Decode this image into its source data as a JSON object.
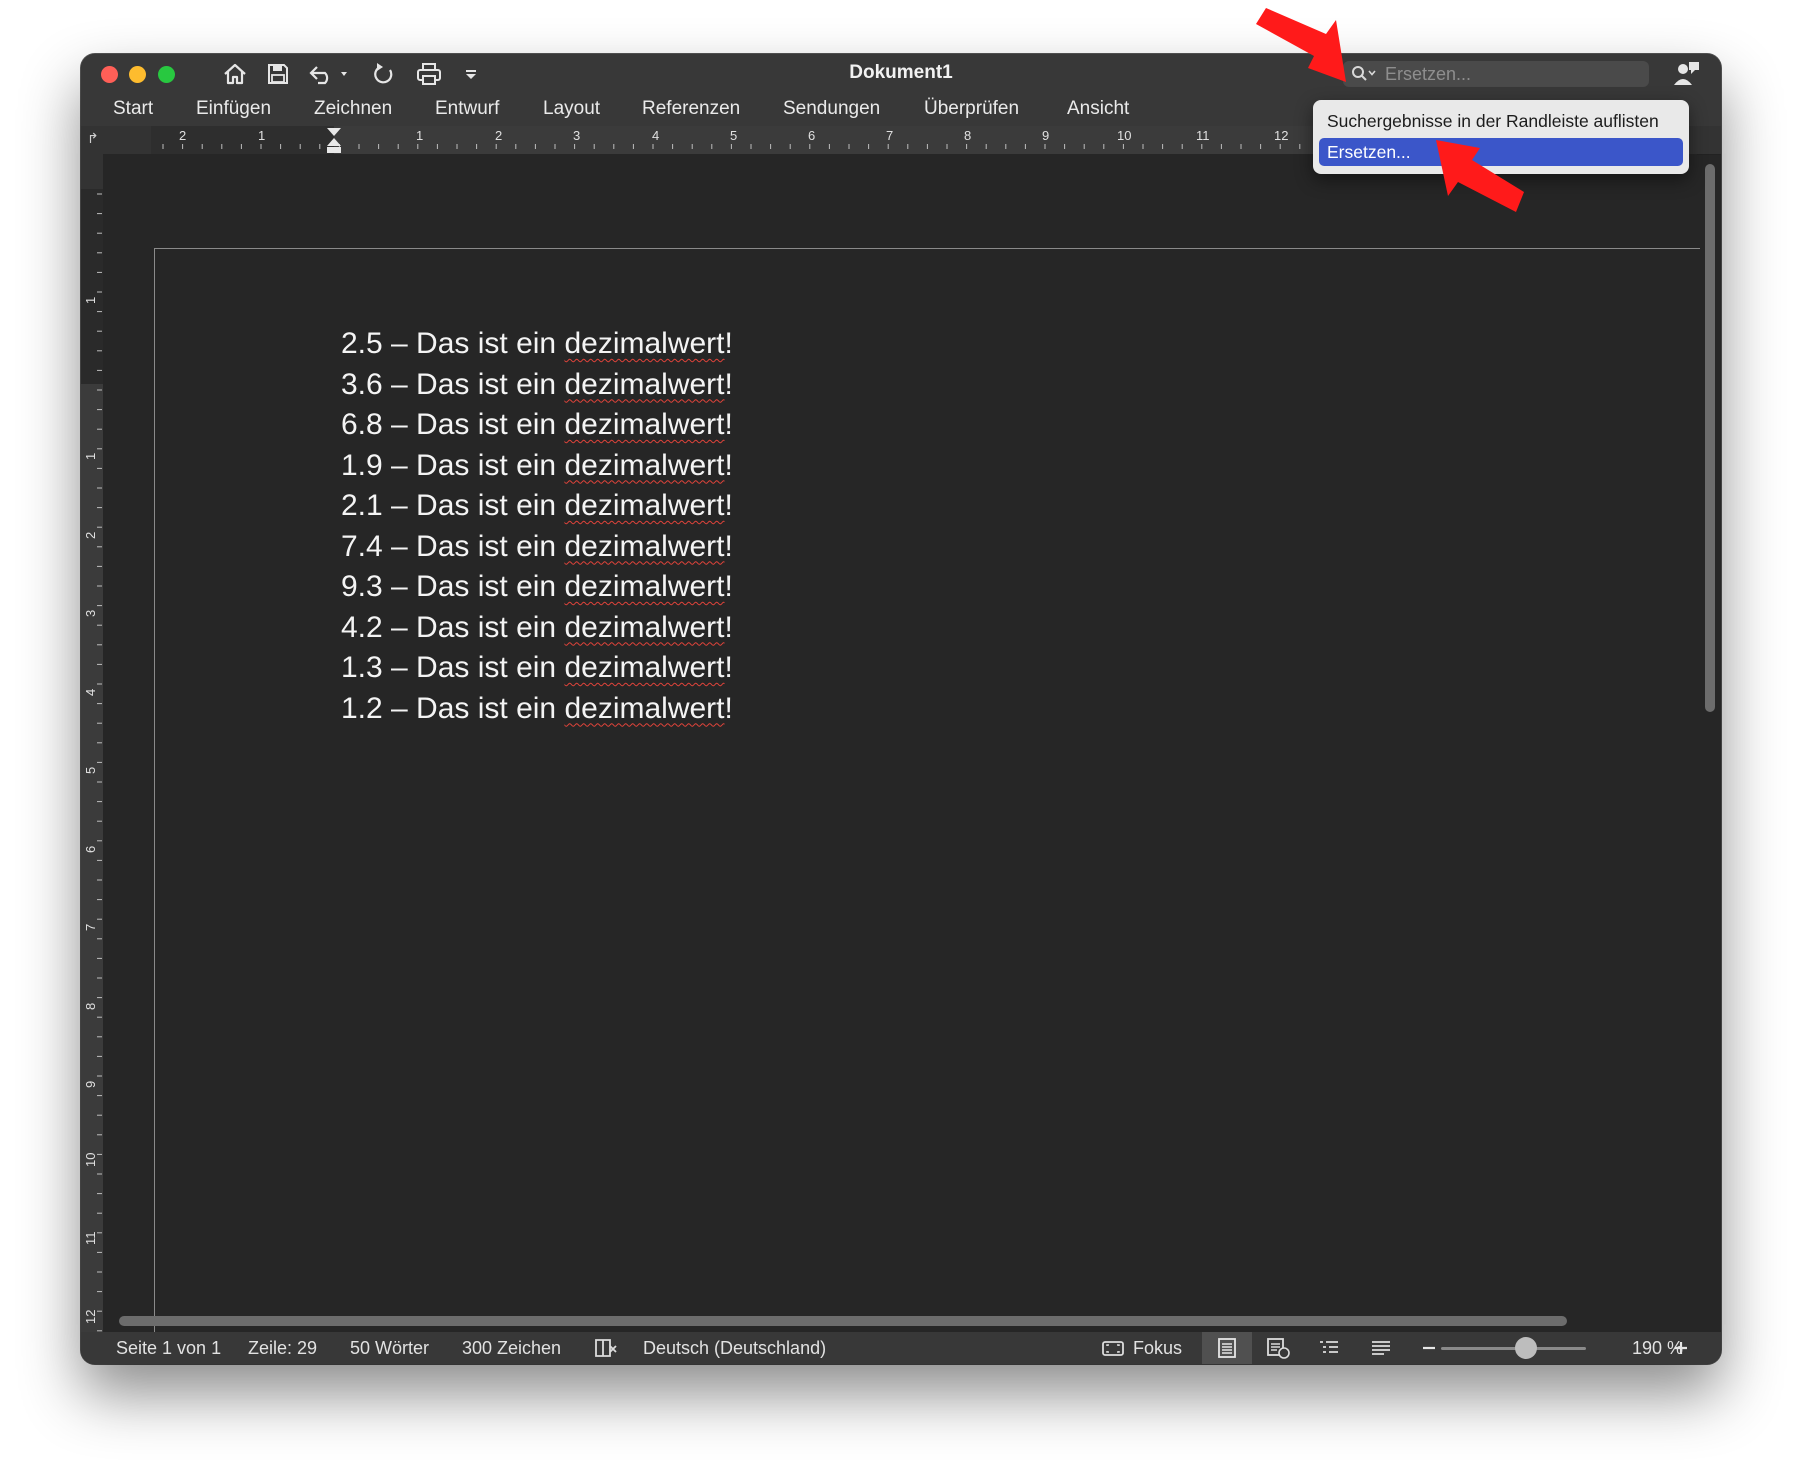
{
  "window": {
    "title": "Dokument1"
  },
  "search": {
    "placeholder": "Ersetzen..."
  },
  "ribbon": {
    "tabs": [
      "Start",
      "Einfügen",
      "Zeichnen",
      "Entwurf",
      "Layout",
      "Referenzen",
      "Sendungen",
      "Überprüfen",
      "Ansicht"
    ]
  },
  "ruler": {
    "h_labels": [
      "2",
      "1",
      "1",
      "2",
      "3",
      "4",
      "5",
      "6",
      "7",
      "8",
      "9",
      "10",
      "11",
      "12"
    ],
    "v_labels": [
      "1",
      "1",
      "2",
      "3",
      "4",
      "5",
      "6",
      "7",
      "8",
      "9",
      "10",
      "11",
      "12"
    ]
  },
  "document": {
    "lines": [
      {
        "prefix": "2.5 – Das ist ein ",
        "word": "dezimalwert",
        "suffix": "!"
      },
      {
        "prefix": "3.6 – Das ist ein ",
        "word": "dezimalwert",
        "suffix": "!"
      },
      {
        "prefix": "6.8 – Das ist ein ",
        "word": "dezimalwert",
        "suffix": "!"
      },
      {
        "prefix": "1.9 – Das ist ein ",
        "word": "dezimalwert",
        "suffix": "!"
      },
      {
        "prefix": "2.1 – Das ist ein ",
        "word": "dezimalwert",
        "suffix": "!"
      },
      {
        "prefix": "7.4 – Das ist ein ",
        "word": "dezimalwert",
        "suffix": "!"
      },
      {
        "prefix": "9.3 – Das ist ein ",
        "word": "dezimalwert",
        "suffix": "!"
      },
      {
        "prefix": "4.2 – Das ist ein ",
        "word": "dezimalwert",
        "suffix": "!"
      },
      {
        "prefix": "1.3 – Das ist ein ",
        "word": "dezimalwert",
        "suffix": "!"
      },
      {
        "prefix": "1.2 – Das ist ein ",
        "word": "dezimalwert",
        "suffix": "!"
      }
    ]
  },
  "dropdown": {
    "items": [
      {
        "label": "Suchergebnisse in der Randleiste auflisten",
        "selected": false
      },
      {
        "label": "Ersetzen...",
        "selected": true
      }
    ]
  },
  "status": {
    "page": "Seite 1 von 1",
    "line": "Zeile: 29",
    "words": "50 Wörter",
    "chars": "300 Zeichen",
    "language": "Deutsch (Deutschland)",
    "focus": "Fokus",
    "zoom": "190 %"
  },
  "colors": {
    "annotation_arrow": "#ff1a1a",
    "selection": "#3b56c9",
    "spellcheck": "#e0433a"
  }
}
